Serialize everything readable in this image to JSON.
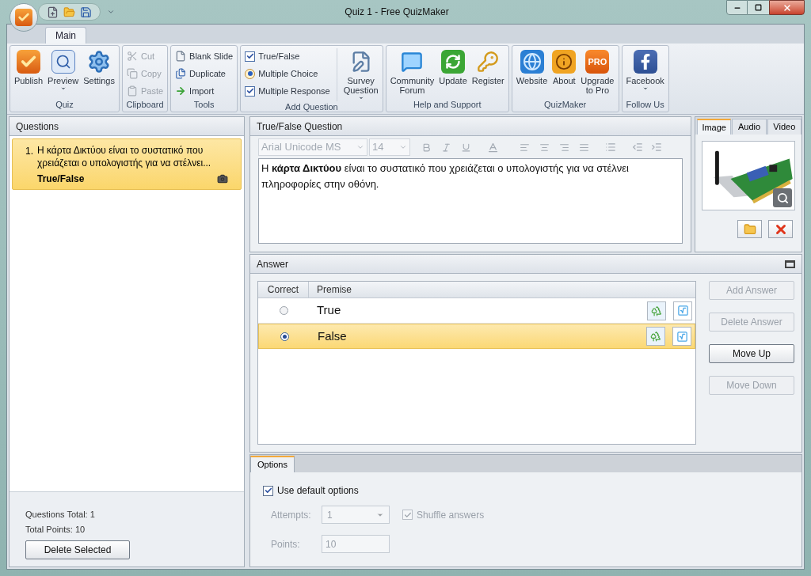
{
  "window": {
    "title": "Quiz 1 - Free QuizMaker"
  },
  "ribbon": {
    "tabs": [
      {
        "label": "Main",
        "selected": true
      }
    ],
    "groups": [
      {
        "title": "Quiz",
        "items": [
          {
            "kind": "large",
            "label": "Publish",
            "dropdown": false
          },
          {
            "kind": "large",
            "label": "Preview",
            "dropdown": true
          },
          {
            "kind": "large",
            "label": "Settings",
            "dropdown": false
          }
        ]
      },
      {
        "title": "Clipboard",
        "items": [
          {
            "kind": "small",
            "label": "Cut",
            "disabled": true
          },
          {
            "kind": "small",
            "label": "Copy",
            "disabled": true
          },
          {
            "kind": "small",
            "label": "Paste",
            "disabled": true
          }
        ]
      },
      {
        "title": "Tools",
        "items": [
          {
            "kind": "small",
            "label": "Blank Slide",
            "disabled": false
          },
          {
            "kind": "small",
            "label": "Duplicate",
            "disabled": false
          },
          {
            "kind": "small",
            "label": "Import",
            "disabled": false
          }
        ]
      },
      {
        "title": "Add Question",
        "items": [
          {
            "kind": "small",
            "label": "True/False",
            "disabled": false
          },
          {
            "kind": "small",
            "label": "Multiple Choice",
            "disabled": false
          },
          {
            "kind": "small",
            "label": "Multiple Response",
            "disabled": false
          },
          {
            "kind": "large",
            "label": "Survey\nQuestion",
            "dropdown": true
          }
        ]
      },
      {
        "title": "Help and Support",
        "items": [
          {
            "kind": "large",
            "label": "Community\nForum",
            "dropdown": false
          },
          {
            "kind": "large",
            "label": "Update",
            "dropdown": false
          },
          {
            "kind": "large",
            "label": "Register",
            "dropdown": false
          }
        ]
      },
      {
        "title": "QuizMaker",
        "items": [
          {
            "kind": "large",
            "label": "Website",
            "dropdown": false
          },
          {
            "kind": "large",
            "label": "About",
            "dropdown": false
          },
          {
            "kind": "large",
            "label": "Upgrade\nto Pro",
            "dropdown": false,
            "badge": "PRO"
          }
        ]
      },
      {
        "title": "Follow Us",
        "items": [
          {
            "kind": "large",
            "label": "Facebook",
            "dropdown": true
          }
        ]
      }
    ]
  },
  "questions": {
    "title": "Questions",
    "items": [
      {
        "number": "1.",
        "text": "Η κάρτα Δικτύου είναι το συστατικό που χρειάζεται ο υπολογιστής για να στέλνει...",
        "type": "True/False",
        "selected": true
      }
    ],
    "total": "Questions Total: 1",
    "points": "Total Points: 10",
    "delete_button": "Delete Selected"
  },
  "editor": {
    "title": "True/False Question",
    "font": "Arial Unicode MS",
    "size": "14",
    "text": "Η **κάρτα Δικτύου** είναι το συστατικό που χρειάζεται ο υπολογιστής για να στέλνει πληροφορίες στην οθόνη."
  },
  "media": {
    "tabs": [
      {
        "label": "Image",
        "selected": true
      },
      {
        "label": "Audio",
        "selected": false
      },
      {
        "label": "Video",
        "selected": false
      }
    ]
  },
  "answer": {
    "title": "Answer",
    "columns": [
      "Correct",
      "Premise"
    ],
    "rows": [
      {
        "text": "True",
        "selected": false
      },
      {
        "text": "False",
        "selected": true
      }
    ],
    "buttons": [
      {
        "label": "Add Answer",
        "disabled": true
      },
      {
        "label": "Delete Answer",
        "disabled": true
      },
      {
        "label": "Move Up",
        "disabled": false
      },
      {
        "label": "Move Down",
        "disabled": true
      }
    ]
  },
  "options": {
    "tabs": [
      {
        "label": "Options",
        "selected": true
      }
    ],
    "use_default": {
      "label": "Use default options",
      "checked": true
    },
    "attempts": {
      "label": "Attempts:",
      "value": "1"
    },
    "shuffle": {
      "label": "Shuffle answers",
      "checked": true
    },
    "points": {
      "label": "Points:",
      "value": "10"
    },
    "disabled": true
  }
}
